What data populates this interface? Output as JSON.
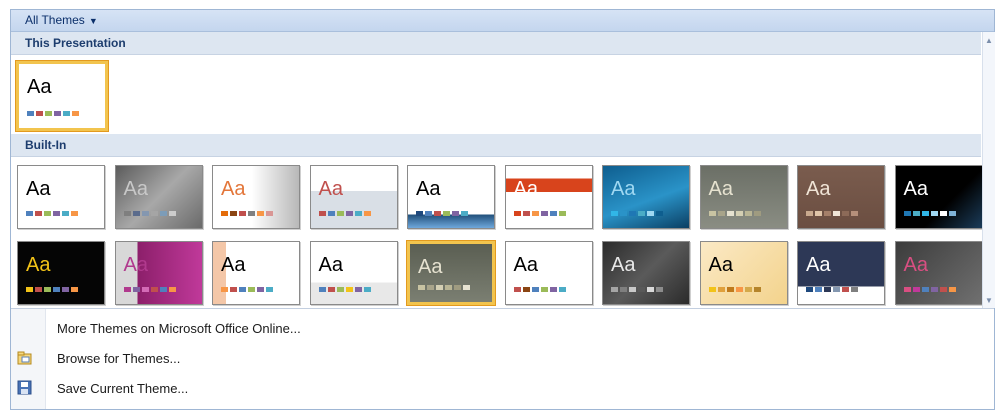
{
  "header": {
    "title": "All Themes",
    "arrow_icon": "▼"
  },
  "sections": {
    "this_presentation": "This Presentation",
    "built_in": "Built-In"
  },
  "thumb_text": "Aa",
  "current_theme": {
    "bg": "#ffffff",
    "fg": "#000000",
    "swatches": [
      "#4f81bd",
      "#c0504d",
      "#9bbb59",
      "#8064a2",
      "#4bacc6",
      "#f79646"
    ]
  },
  "built_in_themes": [
    {
      "bg": "#ffffff",
      "fg": "#000000",
      "sw": [
        "#4f81bd",
        "#c0504d",
        "#9bbb59",
        "#8064a2",
        "#4bacc6",
        "#f79646"
      ]
    },
    {
      "bg": "linear-gradient(135deg,#5c5c5c,#a8a8a8 50%,#6a6a6a)",
      "fg": "#c8c8c8",
      "sw": [
        "#7f7f7f",
        "#5a6b8c",
        "#8497b0",
        "#a5a5a5",
        "#7c9cb8",
        "#cccccc"
      ]
    },
    {
      "bg": "linear-gradient(90deg,#ffffff 45%,#b8b8b8)",
      "fg": "#e3763a",
      "sw": [
        "#e46c0a",
        "#8b4513",
        "#c0504d",
        "#808080",
        "#f79646",
        "#d99694"
      ]
    },
    {
      "bg": "linear-gradient(#ffffff 40%,#d9dfe6 40%)",
      "fg": "#c0504d",
      "sw": [
        "#c0504d",
        "#4f81bd",
        "#9bbb59",
        "#8064a2",
        "#4bacc6",
        "#f79646"
      ]
    },
    {
      "bg": "linear-gradient(#ffffff 78%,#1f4e79 78%,#6fa8dc)",
      "fg": "#000000",
      "sw": [
        "#1f497d",
        "#4f81bd",
        "#c0504d",
        "#9bbb59",
        "#8064a2",
        "#4bacc6"
      ]
    },
    {
      "bg": "linear-gradient(#ffffff 20%,#d8441c 20%,#d8441c 42%,#ffffff 42%)",
      "fg": "#ffffff",
      "sw": [
        "#d8441c",
        "#c0504d",
        "#f79646",
        "#8064a2",
        "#4f81bd",
        "#9bbb59"
      ]
    },
    {
      "bg": "linear-gradient(160deg,#0e5e8f,#2a93c8 55%,#0b3f63)",
      "fg": "#9fd8f2",
      "sw": [
        "#31b6e7",
        "#2a93c8",
        "#1f77b4",
        "#4bacc6",
        "#9fd8f2",
        "#0e5e8f"
      ]
    },
    {
      "bg": "linear-gradient(#6b6f66,#8a8d83)",
      "fg": "#e6e2d0",
      "sw": [
        "#c8c3a2",
        "#a8a48a",
        "#e6e2d0",
        "#d4cfb3",
        "#b9b595",
        "#9f9b80"
      ]
    },
    {
      "bg": "linear-gradient(#7a5c4e,#6b4e41)",
      "fg": "#f0e4d6",
      "sw": [
        "#c9a98e",
        "#e0c4a8",
        "#a57f69",
        "#f0e4d6",
        "#8c6a58",
        "#b58f7a"
      ]
    },
    {
      "bg": "linear-gradient(135deg,#000000 60%,#1b3c5a)",
      "fg": "#ffffff",
      "sw": [
        "#1f77b4",
        "#4bacc6",
        "#31b6e7",
        "#9fd8f2",
        "#ffffff",
        "#7fb2d6"
      ]
    },
    {
      "bg": "#050505",
      "fg": "#f2c318",
      "sw": [
        "#f2c318",
        "#c0504d",
        "#9bbb59",
        "#4f81bd",
        "#8064a2",
        "#f79646"
      ]
    },
    {
      "bg": "linear-gradient(90deg,#d8d8d8 25%,#8c1f6a 25%,#c0399a)",
      "fg": "#b13a8e",
      "sw": [
        "#b13a8e",
        "#8064a2",
        "#d36bb6",
        "#c0504d",
        "#4f81bd",
        "#f79646"
      ]
    },
    {
      "bg": "linear-gradient(90deg,#f4c7a8 15%,#ffffff 15%)",
      "fg": "#000000",
      "sw": [
        "#f79646",
        "#c0504d",
        "#4f81bd",
        "#9bbb59",
        "#8064a2",
        "#4bacc6"
      ]
    },
    {
      "bg": "linear-gradient(#ffffff 65%,#e8e8e8 65%)",
      "fg": "#000000",
      "sw": [
        "#4f81bd",
        "#c0504d",
        "#9bbb59",
        "#f2c318",
        "#8064a2",
        "#4bacc6"
      ]
    },
    {
      "bg": "linear-gradient(#5a5e52,#7b7f72)",
      "fg": "#e6e2d0",
      "sw": [
        "#c8c3a2",
        "#a8a48a",
        "#d4cfb3",
        "#b9b595",
        "#9f9b80",
        "#e6e2d0"
      ]
    },
    {
      "bg": "#ffffff",
      "fg": "#000000",
      "sw": [
        "#c0504d",
        "#8b4513",
        "#4f81bd",
        "#9bbb59",
        "#8064a2",
        "#4bacc6"
      ]
    },
    {
      "bg": "linear-gradient(135deg,#2b2b2b,#5a5a5a 50%,#2b2b2b)",
      "fg": "#e8e8e8",
      "sw": [
        "#a5a5a5",
        "#7f7f7f",
        "#c9c9c9",
        "#595959",
        "#d9d9d9",
        "#8c8c8c"
      ]
    },
    {
      "bg": "linear-gradient(135deg,#fbe9c5,#f3d38c)",
      "fg": "#000000",
      "sw": [
        "#f2c318",
        "#e0a03c",
        "#c07a1c",
        "#f79646",
        "#d4a94a",
        "#b5842a"
      ]
    },
    {
      "bg": "linear-gradient(#2d3856 72%,#ffffff 72%)",
      "fg": "#ffffff",
      "sw": [
        "#1f497d",
        "#4f81bd",
        "#2d3856",
        "#8497b0",
        "#c0504d",
        "#7f7f7f"
      ]
    },
    {
      "bg": "linear-gradient(135deg,#3c3c3c,#707070)",
      "fg": "#d94f82",
      "sw": [
        "#d94f82",
        "#c0399a",
        "#4f81bd",
        "#8064a2",
        "#c0504d",
        "#f79646"
      ]
    }
  ],
  "menu": {
    "more_themes": "More Themes on Microsoft Office Online...",
    "browse": "Browse for Themes...",
    "save": "Save Current Theme..."
  }
}
